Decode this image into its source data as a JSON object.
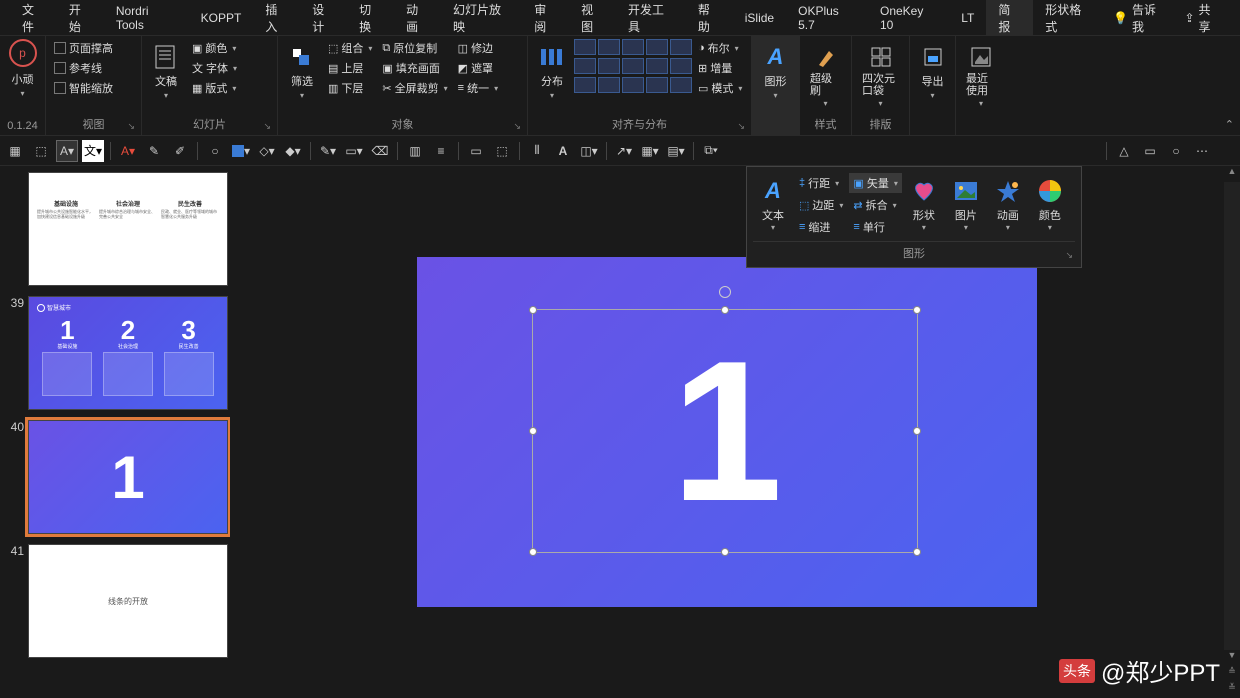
{
  "menu": {
    "tabs": [
      "文件",
      "开始",
      "Nordri Tools",
      "KOPPT",
      "插入",
      "设计",
      "切换",
      "动画",
      "幻灯片放映",
      "审阅",
      "视图",
      "开发工具",
      "帮助",
      "iSlide",
      "OKPlus 5.7",
      "OneKey 10",
      "LT",
      "简报",
      "形状格式"
    ],
    "activeIndex": 17,
    "tell_me": "告诉我",
    "share": "共享"
  },
  "ribbon": {
    "left": {
      "logo_label": "小顽",
      "version": "0.1.24"
    },
    "group_view": {
      "items": [
        "页面撑高",
        "参考线",
        "智能缩放"
      ],
      "label": "视图"
    },
    "group_slides": {
      "big": "文稿",
      "items": [
        "颜色",
        "字体",
        "版式"
      ],
      "label": "幻灯片"
    },
    "group_object": {
      "big": "筛选",
      "col1": [
        "组合",
        "上层",
        "下层"
      ],
      "col2": [
        "原位复制",
        "填充画面",
        "全屏裁剪"
      ],
      "col3": [
        "修边",
        "遮罩",
        "统一"
      ],
      "label": "对象"
    },
    "group_align": {
      "big": "分布",
      "col2": [
        "布尔",
        "增量",
        "模式"
      ],
      "label": "对齐与分布"
    },
    "group_shape": {
      "big": "图形"
    },
    "group_style": {
      "big": "超级刷",
      "label": "样式"
    },
    "group_layout": {
      "big": "四次元口袋",
      "label": "排版"
    },
    "group_export": {
      "big": "导出"
    },
    "group_recent": {
      "big": "最近使用"
    },
    "collapse": "⌃"
  },
  "panel": {
    "text_btn": "文本",
    "col1": [
      "行距",
      "边距",
      "缩进"
    ],
    "col2": [
      "矢量",
      "拆合",
      "单行"
    ],
    "shape": "形状",
    "image": "图片",
    "anim": "动画",
    "color": "颜色",
    "footer": "图形"
  },
  "thumbs": [
    {
      "num": "",
      "type": "t38",
      "cols": [
        {
          "h": "基础设施",
          "p": "提升城市公共设施智能化水平，加快建设信息基础设施升级"
        },
        {
          "h": "社会治理",
          "p": "提升城市综合治理与城市安全、完善公共安全"
        },
        {
          "h": "民生改善",
          "p": "民政、就业、医疗等领域的城市智慧化公共服务升级"
        }
      ]
    },
    {
      "num": "39",
      "type": "t39",
      "hdr": "智慧城市",
      "cols": [
        {
          "n": "1",
          "h": "基础设施"
        },
        {
          "n": "2",
          "h": "社会治理"
        },
        {
          "n": "3",
          "h": "民生改善"
        }
      ]
    },
    {
      "num": "40",
      "type": "t40",
      "n": "1"
    },
    {
      "num": "41",
      "type": "t41",
      "t": "线条的开放"
    }
  ],
  "slide": {
    "number": "1"
  },
  "watermark": {
    "brand": "头条",
    "author": "@郑少PPT"
  }
}
